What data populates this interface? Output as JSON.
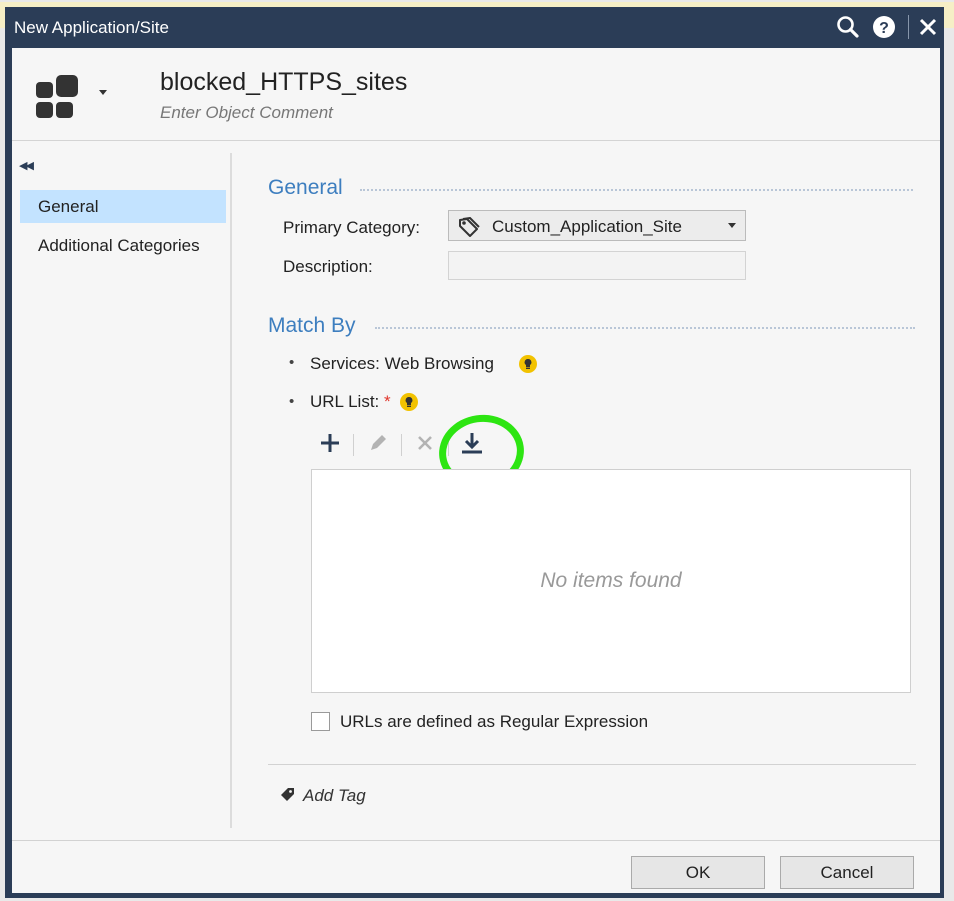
{
  "window": {
    "title": "New Application/Site",
    "search_icon": "search-icon",
    "help_icon": "help-icon",
    "close_icon": "close-icon"
  },
  "header": {
    "object_name": "blocked_HTTPS_sites",
    "comment_placeholder": "Enter Object Comment"
  },
  "nav": {
    "items": [
      {
        "label": "General",
        "active": true
      },
      {
        "label": "Additional Categories",
        "active": false
      }
    ]
  },
  "general": {
    "title": "General",
    "primary_category_label": "Primary Category:",
    "primary_category_value": "Custom_Application_Site",
    "description_label": "Description:",
    "description_value": ""
  },
  "match_by": {
    "title": "Match By",
    "services_label": "Services: Web Browsing",
    "url_list_label": "URL List:",
    "required_marker": "*",
    "empty_text": "No items found",
    "regex_checkbox_label": "URLs are defined as Regular Expression",
    "regex_checked": false
  },
  "tags": {
    "add_tag_label": "Add Tag"
  },
  "footer": {
    "ok_label": "OK",
    "cancel_label": "Cancel"
  },
  "colors": {
    "titlebar": "#2b3d57",
    "section_title": "#3d7ebf",
    "nav_active": "#c3e3ff",
    "highlight_circle": "#2de512",
    "bulb": "#f2c200"
  }
}
